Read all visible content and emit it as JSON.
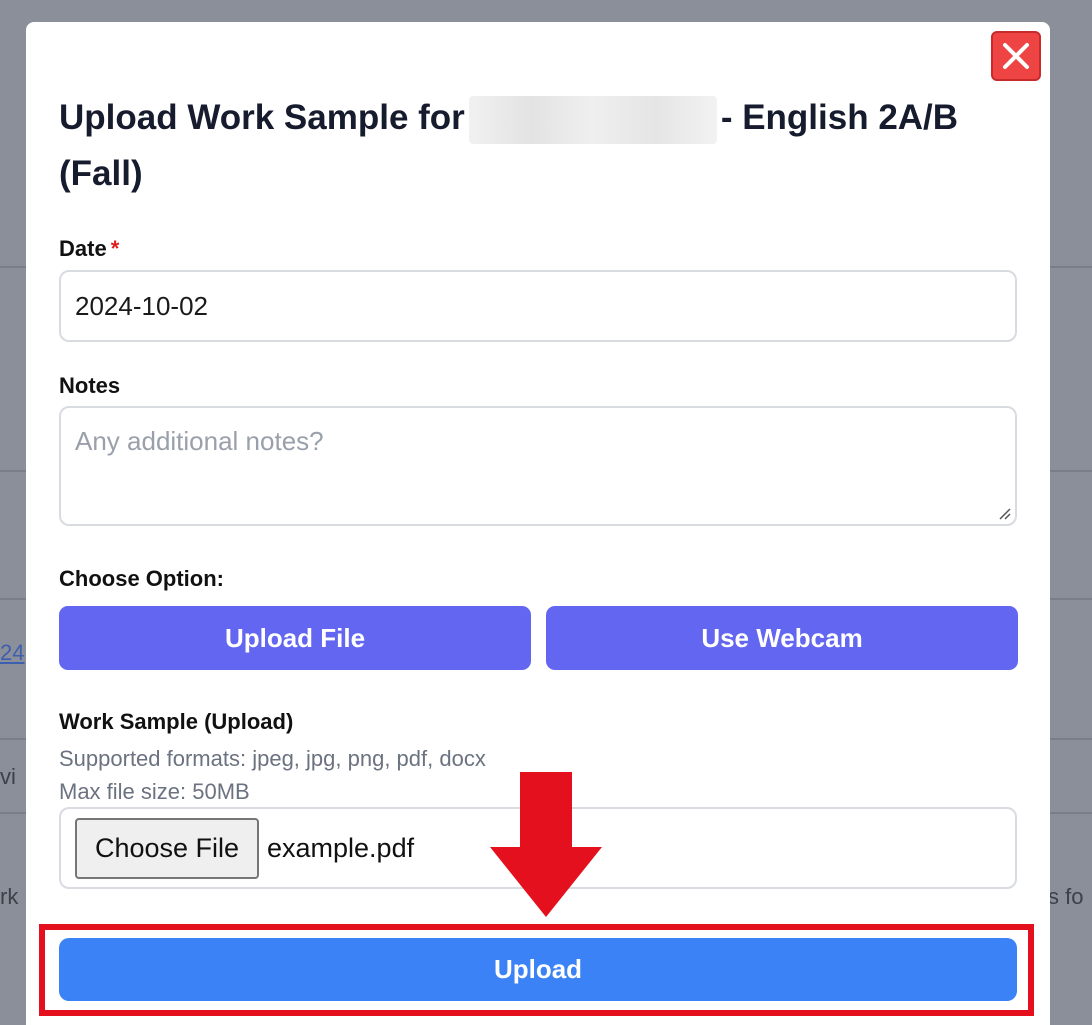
{
  "background": {
    "fragments": [
      "24",
      "vi",
      "rk",
      "s fo"
    ]
  },
  "modal": {
    "title_before": "Upload Work Sample for",
    "title_after": "- English 2A/B (Fall)",
    "close_icon": "close-icon"
  },
  "date_field": {
    "label": "Date",
    "required_marker": "*",
    "value": "2024-10-02"
  },
  "notes_field": {
    "label": "Notes",
    "placeholder": "Any additional notes?"
  },
  "options": {
    "label": "Choose Option:",
    "upload_file": "Upload File",
    "use_webcam": "Use Webcam"
  },
  "work_sample": {
    "label": "Work Sample (Upload)",
    "formats": "Supported formats: jpeg, jpg, png, pdf, docx",
    "max_size": "Max file size: 50MB",
    "choose_file": "Choose File",
    "file_name": "example.pdf"
  },
  "submit": {
    "label": "Upload"
  },
  "colors": {
    "accent_indigo": "#6366f1",
    "accent_blue": "#3b82f6",
    "close_red": "#ee4444",
    "annotation_red": "#e5101d"
  }
}
